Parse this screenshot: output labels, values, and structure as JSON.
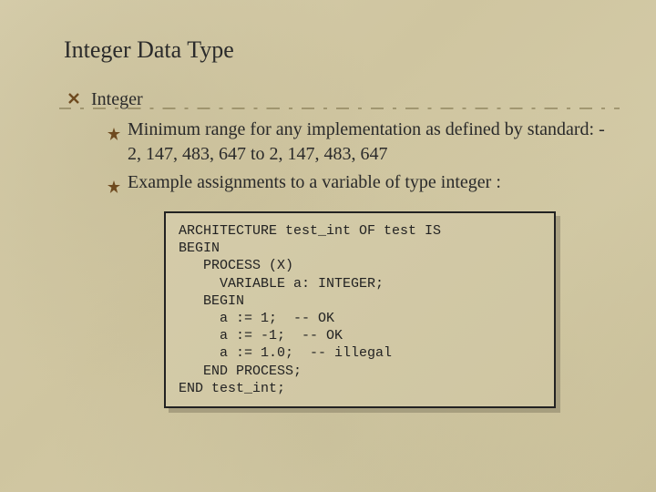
{
  "title": "Integer Data Type",
  "bullets": {
    "l1": "Integer",
    "l2a": "Minimum range for any implementation as defined by standard:  - 2, 147, 483, 647 to 2, 147, 483, 647",
    "l2b": "Example assignments to a variable of type integer :"
  },
  "code": "ARCHITECTURE test_int OF test IS\nBEGIN\n   PROCESS (X)\n     VARIABLE a: INTEGER;\n   BEGIN\n     a := 1;  -- OK\n     a := -1;  -- OK\n     a := 1.0;  -- illegal\n   END PROCESS;\nEND test_int;"
}
